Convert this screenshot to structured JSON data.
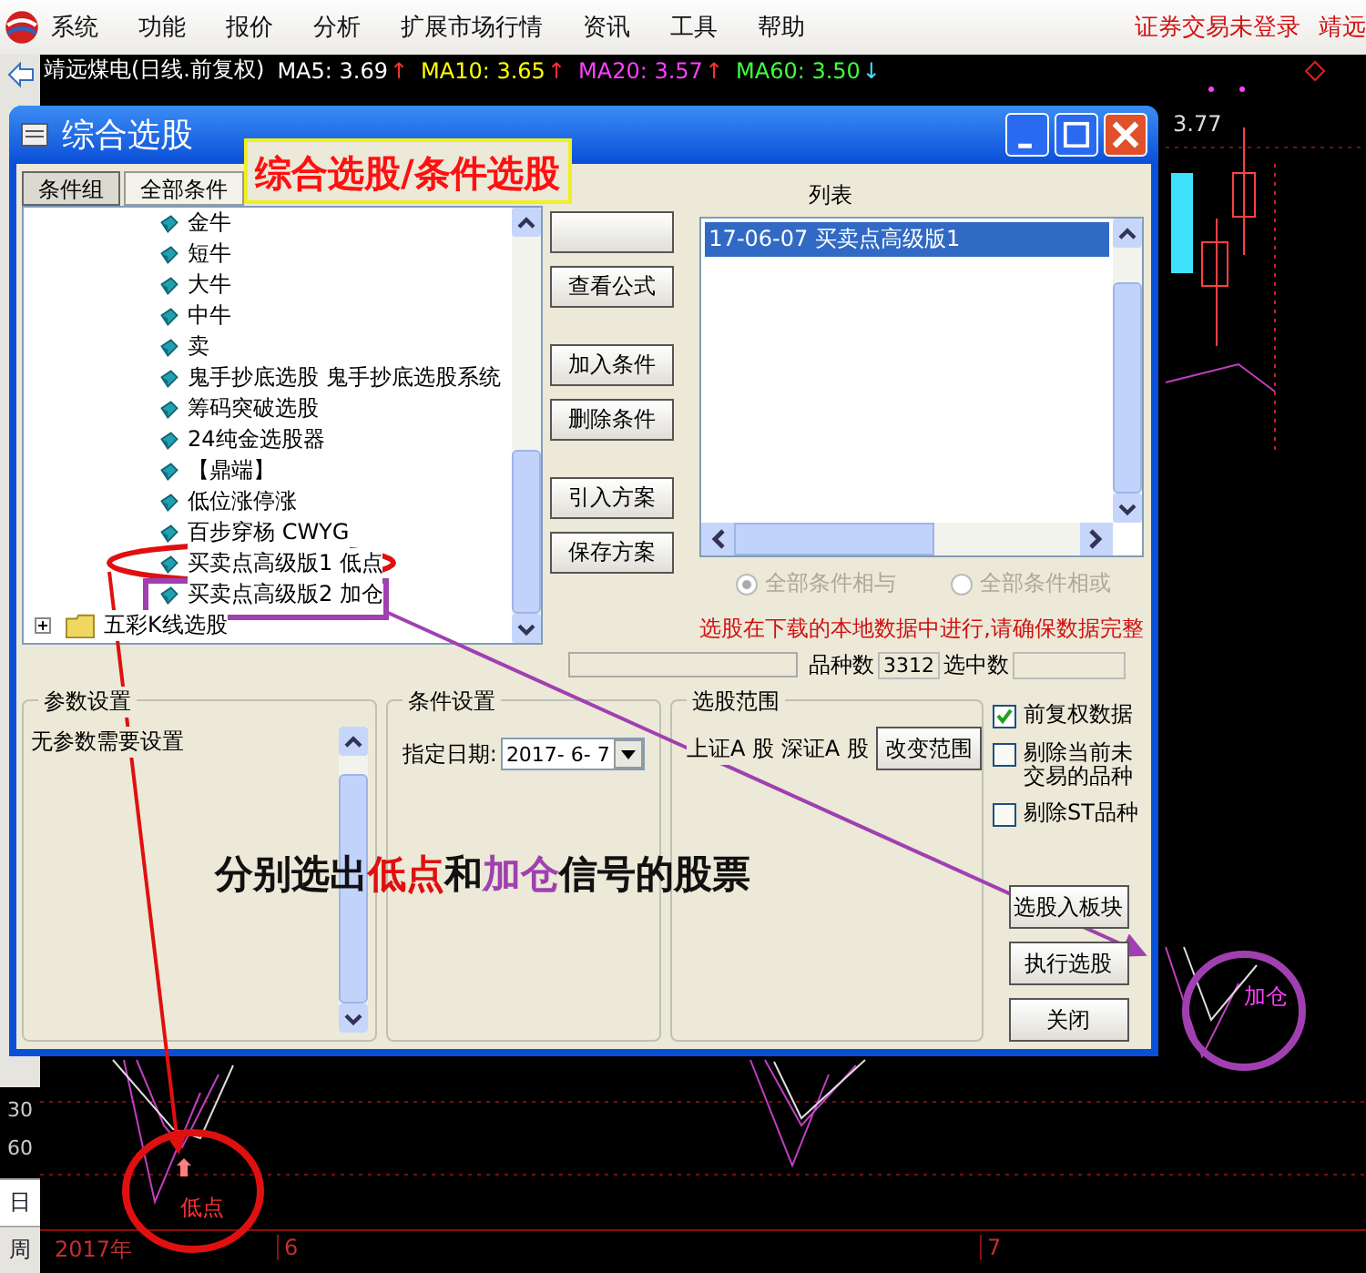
{
  "menu": {
    "items": [
      "系统",
      "功能",
      "报价",
      "分析",
      "扩展市场行情",
      "资讯",
      "工具",
      "帮助"
    ],
    "login_status": "证券交易未登录",
    "stock_cut": "靖远"
  },
  "chart": {
    "title": "靖远煤电(日线.前复权)",
    "indicators": [
      {
        "label": "MA5: 3.69",
        "arrow": "↑",
        "rising": true,
        "color": "#ffffff"
      },
      {
        "label": "MA10: 3.65",
        "arrow": "↑",
        "rising": true,
        "color": "#ffff00"
      },
      {
        "label": "MA20: 3.57",
        "arrow": "↑",
        "rising": true,
        "color": "#ff40ff"
      },
      {
        "label": "MA60: 3.50",
        "arrow": "↓",
        "rising": false,
        "color": "#40ff40"
      }
    ],
    "price_label": "3.77",
    "axis_labels": [
      "30",
      "60"
    ],
    "period_tabs": [
      {
        "label": "日",
        "selected": true
      },
      {
        "label": "周",
        "selected": false
      }
    ],
    "dates": [
      "2017年",
      "6",
      "7"
    ]
  },
  "dialog": {
    "title": "综合选股",
    "tabs": [
      {
        "label": "条件组",
        "selected": true
      },
      {
        "label": "全部条件",
        "selected": false
      }
    ],
    "list_label": "列表",
    "tree": [
      {
        "children": [
          {
            "label": "金牛"
          },
          {
            "label": "短牛"
          },
          {
            "label": "大牛"
          },
          {
            "label": "中牛"
          },
          {
            "label": "卖"
          },
          {
            "label": "鬼手抄底选股  鬼手抄底选股系统"
          },
          {
            "label": "筹码突破选股"
          },
          {
            "label": "24纯金选股器"
          },
          {
            "label": "【鼎端】"
          },
          {
            "label": "低位涨停涨"
          },
          {
            "label": "百步穿杨 CWYG"
          },
          {
            "label": "买卖点高级版1  低点"
          },
          {
            "label": "买卖点高级版2  加仓"
          }
        ]
      },
      {
        "label": "五彩K线选股",
        "kind": "folder",
        "expanded": false
      }
    ],
    "buttons": [
      "查看公式",
      "加入条件",
      "删除条件",
      "引入方案",
      "保存方案"
    ],
    "selected_list": [
      {
        "text": "17-06-07  买卖点高级版1",
        "selected": true
      }
    ],
    "logic": [
      {
        "label": "全部条件相与",
        "selected": true,
        "disabled": true
      },
      {
        "label": "全部条件相或",
        "selected": false,
        "disabled": true
      }
    ],
    "note": "选股在下载的本地数据中进行,请确保数据完整",
    "count_label": "品种数",
    "count_value": "3312",
    "picked_label": "选中数",
    "params": {
      "title": "参数设置",
      "text": "无参数需要设置"
    },
    "condition": {
      "title": "条件设置",
      "date_label": "指定日期:",
      "date_value": "2017- 6- 7"
    },
    "scope": {
      "title": "选股范围",
      "markets": "上证A 股  深证A 股",
      "change_button": "改变范围"
    },
    "options": [
      {
        "label": "前复权数据",
        "checked": true
      },
      {
        "label": "剔除当前未交易的品种",
        "checked": false
      },
      {
        "label": "剔除ST品种",
        "checked": false
      }
    ],
    "actions": [
      "选股入板块",
      "执行选股",
      "关闭"
    ]
  },
  "annotations": {
    "headline": "综合选股/条件选股",
    "caption": [
      {
        "text": "分别选出",
        "color": "#111111"
      },
      {
        "text": "低点",
        "color": "#e01010"
      },
      {
        "text": "和",
        "color": "#111111"
      },
      {
        "text": "加仓",
        "color": "#a040b0"
      },
      {
        "text": "信号的股票",
        "color": "#111111"
      }
    ],
    "low_label": "低点",
    "add_label": "加仓"
  }
}
